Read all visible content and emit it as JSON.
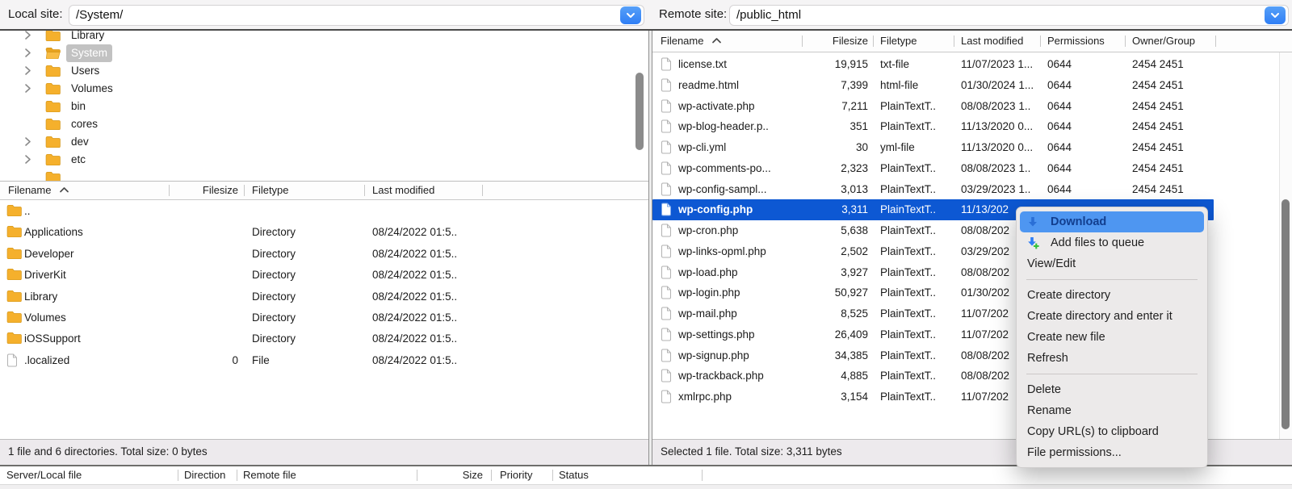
{
  "colors": {
    "selection_blue": "#0d58d3",
    "menu_highlight_blue": "#4e96f1",
    "folder_yellow": "#f5b02c",
    "accent_button_blue": "#2f7ef5",
    "statusbar_bg": "#edeaed"
  },
  "local_site": {
    "label": "Local site:",
    "path": "/System/"
  },
  "remote_site": {
    "label": "Remote site:",
    "path": "/public_html"
  },
  "local_tree": {
    "items": [
      {
        "label": "Library",
        "expandable": true,
        "selected": false,
        "partial": "top"
      },
      {
        "label": "System",
        "expandable": true,
        "selected": true,
        "partial": null
      },
      {
        "label": "Users",
        "expandable": true,
        "selected": false,
        "partial": null
      },
      {
        "label": "Volumes",
        "expandable": true,
        "selected": false,
        "partial": null
      },
      {
        "label": "bin",
        "expandable": false,
        "selected": false,
        "partial": null
      },
      {
        "label": "cores",
        "expandable": false,
        "selected": false,
        "partial": null
      },
      {
        "label": "dev",
        "expandable": true,
        "selected": false,
        "partial": null
      },
      {
        "label": "etc",
        "expandable": true,
        "selected": false,
        "partial": null
      },
      {
        "label": "",
        "expandable": false,
        "selected": false,
        "partial": "bottom"
      }
    ]
  },
  "local_list": {
    "columns": [
      "Filename",
      "Filesize",
      "Filetype",
      "Last modified"
    ],
    "rows": [
      {
        "icon": "folder",
        "name": "..",
        "size": "",
        "type": "",
        "modified": ""
      },
      {
        "icon": "folder",
        "name": "Applications",
        "size": "",
        "type": "Directory",
        "modified": "08/24/2022 01:5.."
      },
      {
        "icon": "folder",
        "name": "Developer",
        "size": "",
        "type": "Directory",
        "modified": "08/24/2022 01:5.."
      },
      {
        "icon": "folder",
        "name": "DriverKit",
        "size": "",
        "type": "Directory",
        "modified": "08/24/2022 01:5.."
      },
      {
        "icon": "folder",
        "name": "Library",
        "size": "",
        "type": "Directory",
        "modified": "08/24/2022 01:5.."
      },
      {
        "icon": "folder",
        "name": "Volumes",
        "size": "",
        "type": "Directory",
        "modified": "08/24/2022 01:5.."
      },
      {
        "icon": "folder",
        "name": "iOSSupport",
        "size": "",
        "type": "Directory",
        "modified": "08/24/2022 01:5.."
      },
      {
        "icon": "file",
        "name": ".localized",
        "size": "0",
        "type": "File",
        "modified": "08/24/2022 01:5.."
      }
    ],
    "status": "1 file and 6 directories. Total size: 0 bytes"
  },
  "remote_list": {
    "columns": [
      "Filename",
      "Filesize",
      "Filetype",
      "Last modified",
      "Permissions",
      "Owner/Group"
    ],
    "rows": [
      {
        "icon": "file",
        "name": "license.txt",
        "size": "19,915",
        "type": "txt-file",
        "modified": "11/07/2023 1...",
        "perms": "0644",
        "owner": "2454 2451",
        "selected": false
      },
      {
        "icon": "file",
        "name": "readme.html",
        "size": "7,399",
        "type": "html-file",
        "modified": "01/30/2024 1...",
        "perms": "0644",
        "owner": "2454 2451",
        "selected": false
      },
      {
        "icon": "file",
        "name": "wp-activate.php",
        "size": "7,211",
        "type": "PlainTextT..",
        "modified": "08/08/2023 1..",
        "perms": "0644",
        "owner": "2454 2451",
        "selected": false
      },
      {
        "icon": "file",
        "name": "wp-blog-header.p..",
        "size": "351",
        "type": "PlainTextT..",
        "modified": "11/13/2020 0...",
        "perms": "0644",
        "owner": "2454 2451",
        "selected": false
      },
      {
        "icon": "file",
        "name": "wp-cli.yml",
        "size": "30",
        "type": "yml-file",
        "modified": "11/13/2020 0...",
        "perms": "0644",
        "owner": "2454 2451",
        "selected": false
      },
      {
        "icon": "file",
        "name": "wp-comments-po...",
        "size": "2,323",
        "type": "PlainTextT..",
        "modified": "08/08/2023 1..",
        "perms": "0644",
        "owner": "2454 2451",
        "selected": false
      },
      {
        "icon": "file",
        "name": "wp-config-sampl...",
        "size": "3,013",
        "type": "PlainTextT..",
        "modified": "03/29/2023 1..",
        "perms": "0644",
        "owner": "2454 2451",
        "selected": false
      },
      {
        "icon": "file",
        "name": "wp-config.php",
        "size": "3,311",
        "type": "PlainTextT..",
        "modified": "11/13/202",
        "perms": "",
        "owner": "",
        "selected": true
      },
      {
        "icon": "file",
        "name": "wp-cron.php",
        "size": "5,638",
        "type": "PlainTextT..",
        "modified": "08/08/202",
        "perms": "",
        "owner": "",
        "selected": false
      },
      {
        "icon": "file",
        "name": "wp-links-opml.php",
        "size": "2,502",
        "type": "PlainTextT..",
        "modified": "03/29/202",
        "perms": "",
        "owner": "",
        "selected": false
      },
      {
        "icon": "file",
        "name": "wp-load.php",
        "size": "3,927",
        "type": "PlainTextT..",
        "modified": "08/08/202",
        "perms": "",
        "owner": "",
        "selected": false
      },
      {
        "icon": "file",
        "name": "wp-login.php",
        "size": "50,927",
        "type": "PlainTextT..",
        "modified": "01/30/202",
        "perms": "",
        "owner": "",
        "selected": false
      },
      {
        "icon": "file",
        "name": "wp-mail.php",
        "size": "8,525",
        "type": "PlainTextT..",
        "modified": "11/07/202",
        "perms": "",
        "owner": "",
        "selected": false
      },
      {
        "icon": "file",
        "name": "wp-settings.php",
        "size": "26,409",
        "type": "PlainTextT..",
        "modified": "11/07/202",
        "perms": "",
        "owner": "",
        "selected": false
      },
      {
        "icon": "file",
        "name": "wp-signup.php",
        "size": "34,385",
        "type": "PlainTextT..",
        "modified": "08/08/202",
        "perms": "",
        "owner": "",
        "selected": false
      },
      {
        "icon": "file",
        "name": "wp-trackback.php",
        "size": "4,885",
        "type": "PlainTextT..",
        "modified": "08/08/202",
        "perms": "",
        "owner": "",
        "selected": false
      },
      {
        "icon": "file",
        "name": "xmlrpc.php",
        "size": "3,154",
        "type": "PlainTextT..",
        "modified": "11/07/202",
        "perms": "",
        "owner": "",
        "selected": false
      }
    ],
    "status": "Selected 1 file. Total size: 3,311 bytes"
  },
  "transfer_queue": {
    "columns": [
      "Server/Local file",
      "Direction",
      "Remote file",
      "Size",
      "Priority",
      "Status"
    ]
  },
  "context_menu": {
    "items": [
      {
        "label": "Download",
        "icon": "download-icon",
        "highlighted": true
      },
      {
        "label": "Add files to queue",
        "icon": "add-to-queue-icon",
        "highlighted": false
      },
      {
        "label": "View/Edit",
        "icon": null,
        "highlighted": false
      },
      {
        "separator": true
      },
      {
        "label": "Create directory",
        "icon": null,
        "highlighted": false
      },
      {
        "label": "Create directory and enter it",
        "icon": null,
        "highlighted": false
      },
      {
        "label": "Create new file",
        "icon": null,
        "highlighted": false
      },
      {
        "label": "Refresh",
        "icon": null,
        "highlighted": false
      },
      {
        "separator": true
      },
      {
        "label": "Delete",
        "icon": null,
        "highlighted": false
      },
      {
        "label": "Rename",
        "icon": null,
        "highlighted": false
      },
      {
        "label": "Copy URL(s) to clipboard",
        "icon": null,
        "highlighted": false
      },
      {
        "label": "File permissions...",
        "icon": null,
        "highlighted": false
      }
    ]
  }
}
